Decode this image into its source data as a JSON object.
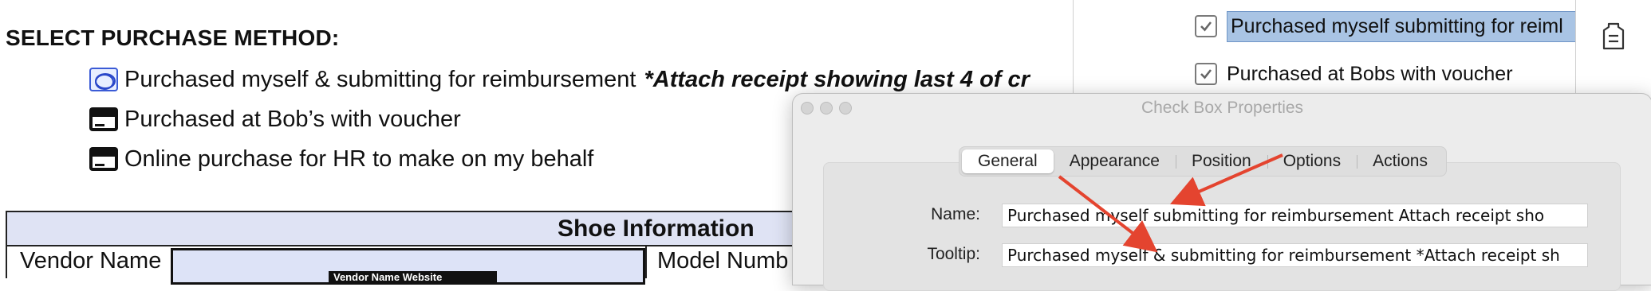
{
  "document": {
    "heading": "SELECT PURCHASE METHOD:",
    "options": [
      {
        "label": "Purchased myself & submitting for reimbursement",
        "note": "*Attach receipt showing last 4 of cr"
      },
      {
        "label": "Purchased at Bob’s with voucher"
      },
      {
        "label": "Online purchase for HR to make on my behalf"
      }
    ],
    "table": {
      "header": "Shoe Information",
      "vendor_label": "Vendor Name",
      "vendor_tag": "Vendor Name Website",
      "model_label": "Model Numb"
    }
  },
  "fields_panel": {
    "items": [
      {
        "label": "Purchased myself  submitting for reiml",
        "checked": true,
        "active": true
      },
      {
        "label": "Purchased at Bobs with voucher",
        "checked": true,
        "active": false
      }
    ],
    "side_icon": "form-tag-icon"
  },
  "dialog": {
    "title": "Check Box Properties",
    "tabs": [
      "General",
      "Appearance",
      "Position",
      "Options",
      "Actions"
    ],
    "active_tab": "General",
    "name_label": "Name:",
    "name_value": "Purchased myself  submitting for reimbursement Attach receipt sho",
    "tooltip_label": "Tooltip:",
    "tooltip_value": "Purchased myself & submitting for reimbursement *Attach receipt sh"
  },
  "colors": {
    "selection": "#a9c4e4",
    "table_header": "#dfe3f4",
    "annotation_arrow": "#e4442f",
    "selected_box": "#3b5bd6"
  }
}
